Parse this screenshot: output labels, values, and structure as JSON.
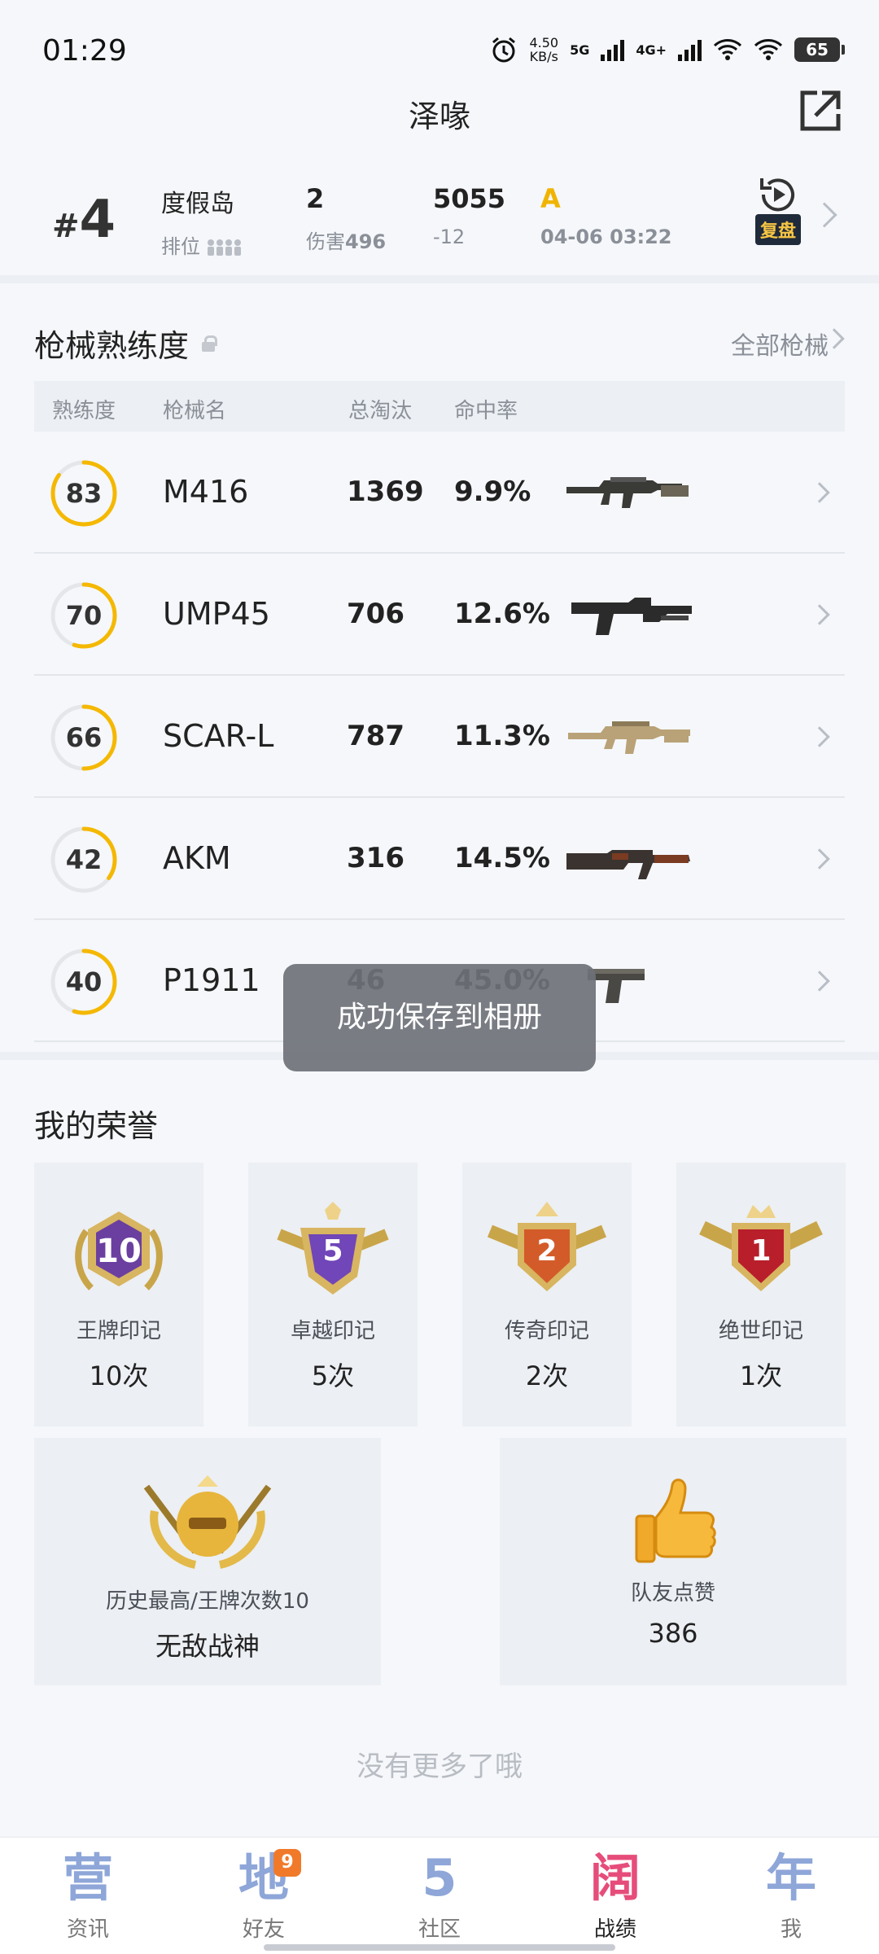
{
  "status_bar": {
    "time": "01:29",
    "speed_value": "4.50",
    "speed_unit": "KB/s",
    "net1": "5G",
    "net2": "4G+",
    "battery": "65"
  },
  "header": {
    "title": "泽喙"
  },
  "match": {
    "rank_hash": "#",
    "rank_number": "4",
    "map": "度假岛",
    "mode": "排位",
    "kills": "2",
    "damage_label": "伤害",
    "damage_value": "496",
    "score": "5055",
    "score_change": "-12",
    "grade": "A",
    "datetime": "04-06 03:22",
    "replay_label": "复盘"
  },
  "guns": {
    "title": "枪械熟练度",
    "all_link": "全部枪械",
    "headers": {
      "proficiency": "熟练度",
      "name": "枪械名",
      "kills": "总淘汰",
      "accuracy": "命中率"
    },
    "rows": [
      {
        "level": "83",
        "progress": 0.85,
        "name": "M416",
        "kills": "1369",
        "accuracy": "9.9%",
        "icon": "m416-rifle-icon"
      },
      {
        "level": "70",
        "progress": 0.55,
        "name": "UMP45",
        "kills": "706",
        "accuracy": "12.6%",
        "icon": "ump45-smg-icon"
      },
      {
        "level": "66",
        "progress": 0.5,
        "name": "SCAR-L",
        "kills": "787",
        "accuracy": "11.3%",
        "icon": "scar-l-rifle-icon"
      },
      {
        "level": "42",
        "progress": 0.35,
        "name": "AKM",
        "kills": "316",
        "accuracy": "14.5%",
        "icon": "akm-rifle-icon"
      },
      {
        "level": "40",
        "progress": 0.55,
        "name": "P1911",
        "kills": "46",
        "accuracy": "45.0%",
        "icon": "p1911-pistol-icon"
      }
    ]
  },
  "toast": "成功保存到相册",
  "honors": {
    "title": "我的荣誉",
    "badges": [
      {
        "label": "王牌印记",
        "count": "10次",
        "badge_text": "10"
      },
      {
        "label": "卓越印记",
        "count": "5次",
        "badge_text": "5"
      },
      {
        "label": "传奇印记",
        "count": "2次",
        "badge_text": "2"
      },
      {
        "label": "绝世印记",
        "count": "1次",
        "badge_text": "1"
      }
    ],
    "history": {
      "label": "历史最高/王牌次数10",
      "value": "无敌战神"
    },
    "likes": {
      "label": "队友点赞",
      "value": "386"
    }
  },
  "footer_note": "没有更多了哦",
  "bottom_nav": [
    {
      "glyph": "营",
      "label": "资讯"
    },
    {
      "glyph": "地",
      "label": "好友",
      "badge": "9"
    },
    {
      "glyph": "5",
      "label": "社区"
    },
    {
      "glyph": "阔",
      "label": "战绩",
      "active": true
    },
    {
      "glyph": "年",
      "label": "我"
    }
  ],
  "colors": {
    "accent": "#f5b800",
    "active_nav": "#e64d7a",
    "nav": "#8ea6d8"
  }
}
